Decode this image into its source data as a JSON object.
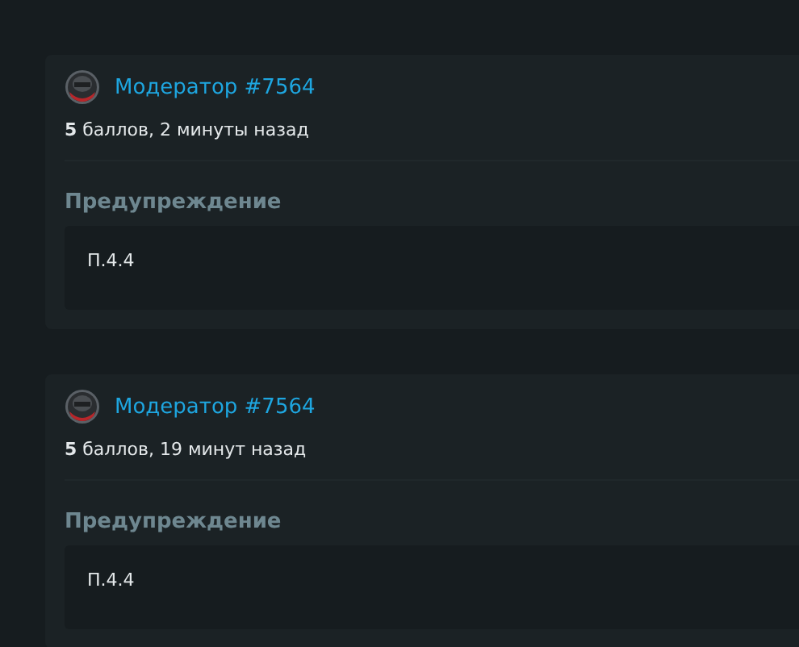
{
  "warnings": [
    {
      "author": "Модератор #7564",
      "meta": "**5** баллов, 2 минуты назад",
      "type": "Предупреждение",
      "reason": "П.4.4"
    },
    {
      "author": "Модератор #7564",
      "meta": "**5** баллов, 19 минут назад",
      "type": "Предупреждение",
      "reason": "П.4.4"
    }
  ]
}
